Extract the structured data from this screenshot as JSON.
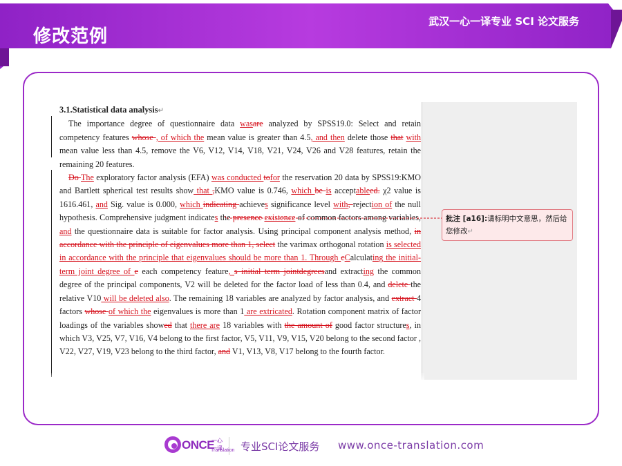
{
  "header": {
    "slide_title": "修改范例",
    "service_title": "武汉一心一译专业 SCI 论文服务",
    "band_color": "#9b29c8"
  },
  "document": {
    "heading": "3.1.Statistical data analysis",
    "para1": [
      {
        "t": "The importance degree of questionnaire data "
      },
      {
        "t": "was",
        "c": "ins"
      },
      {
        "t": "are",
        "c": "del"
      },
      {
        "t": " analyzed by SPSS19.0: Select and retain competency features "
      },
      {
        "t": "whose ",
        "c": "del"
      },
      {
        "t": ", of which the",
        "c": "ins"
      },
      {
        "t": " mean value is greater than 4.5"
      },
      {
        "t": ", and then",
        "c": "ins"
      },
      {
        "t": " delete those "
      },
      {
        "t": "that",
        "c": "del"
      },
      {
        "t": " "
      },
      {
        "t": "with",
        "c": "ins"
      },
      {
        "t": " mean value less than 4.5, remove the V6, V12, V14, V18, V21, V24, V26 and V28 features, retain the remaining 20 features."
      }
    ],
    "para2": [
      {
        "t": "Do ",
        "c": "del"
      },
      {
        "t": "The",
        "c": "ins"
      },
      {
        "t": " exploratory factor analysis (EFA) "
      },
      {
        "t": "was conducted ",
        "c": "ins"
      },
      {
        "t": "to",
        "c": "del"
      },
      {
        "t": "for",
        "c": "ins"
      },
      {
        "t": " the reservation 20 data by SPSS19:KMO and Bartlett spherical test results show"
      },
      {
        "t": " that ",
        "c": "ins"
      },
      {
        "t": ",",
        "c": "del"
      },
      {
        "t": "KMO value is 0.746, "
      },
      {
        "t": "which ",
        "c": "ins"
      },
      {
        "t": "be ",
        "c": "del"
      },
      {
        "t": "is",
        "c": "ins"
      },
      {
        "t": " accept"
      },
      {
        "t": "able",
        "c": "ins"
      },
      {
        "t": "ed.",
        "c": "del"
      },
      {
        "t": " χ2 value is 1616.461, "
      },
      {
        "t": "and",
        "c": "ins"
      },
      {
        "t": " Sig. value is 0.000, "
      },
      {
        "t": "which ",
        "c": "ins"
      },
      {
        "t": "indicating ",
        "c": "del"
      },
      {
        "t": "achieve"
      },
      {
        "t": "s",
        "c": "ins"
      },
      {
        "t": " significance level "
      },
      {
        "t": "with",
        "c": "ins"
      },
      {
        "t": ", ",
        "c": "del"
      },
      {
        "t": "reject"
      },
      {
        "t": "ion of",
        "c": "ins"
      },
      {
        "t": " the null hypothesis. Comprehensive judgment indicate"
      },
      {
        "t": "s",
        "c": "ins"
      },
      {
        "t": " the "
      },
      {
        "t": "presence",
        "c": "del"
      },
      {
        "t": " "
      },
      {
        "t": "existence",
        "c": "ins"
      },
      {
        "t": " of common factors among variables, "
      },
      {
        "t": "and",
        "c": "ins"
      },
      {
        "t": " the questionnaire data is suitable for factor analysis. Using principal component analysis method, "
      },
      {
        "t": "in accordance with the principle of eigenvalues more than 1, select",
        "c": "del"
      },
      {
        "t": " the varimax orthogonal rotation "
      },
      {
        "t": "is selected in accordance with the principle that eigenvalues should be more than 1. Through ",
        "c": "ins"
      },
      {
        "t": "c",
        "c": "del"
      },
      {
        "t": "C",
        "c": "ins"
      },
      {
        "t": "alculat"
      },
      {
        "t": "ing the initial-term joint degree of ",
        "c": "ins"
      },
      {
        "t": "e",
        "c": "del"
      },
      {
        "t": " each competency feature"
      },
      {
        "t": ", ",
        "c": "ins"
      },
      {
        "t": "s initial term jointdegrees",
        "c": "del"
      },
      {
        "t": "and extract"
      },
      {
        "t": "ing",
        "c": "ins"
      },
      {
        "t": " the common degree of the principal components, V2 will be deleted for the factor load of less than 0.4, and "
      },
      {
        "t": "delete ",
        "c": "del"
      },
      {
        "t": "the relative V10"
      },
      {
        "t": " will be deleted also",
        "c": "ins"
      },
      {
        "t": ". The remaining 18 variables are analyzed by factor analysis, and "
      },
      {
        "t": "extract ",
        "c": "del"
      },
      {
        "t": "4 factors "
      },
      {
        "t": "whose ",
        "c": "del"
      },
      {
        "t": "of which the",
        "c": "ins"
      },
      {
        "t": " eigenvalues is more than 1"
      },
      {
        "t": " are extricated",
        "c": "ins"
      },
      {
        "t": ". Rotation component matrix of factor loadings of the variables show"
      },
      {
        "t": "ed",
        "c": "del"
      },
      {
        "t": " that "
      },
      {
        "t": "there are",
        "c": "ins"
      },
      {
        "t": " 18 variables with "
      },
      {
        "t": "the amount of",
        "c": "del"
      },
      {
        "t": " good factor structure"
      },
      {
        "t": "s",
        "c": "ins"
      },
      {
        "t": ", in which V3, V25, V7, V16, V4 belong to the first factor, V5, V11, V9, V15, V20 belong to the second factor , V22, V27, V19, V23 belong to the third factor, "
      },
      {
        "t": "and",
        "c": "del"
      },
      {
        "t": " V1, V13, V8, V17 belong to the fourth factor."
      }
    ]
  },
  "comment": {
    "tag": "批注 [a16]:",
    "text": "请标明中文意思，然后给您修改"
  },
  "footer": {
    "logo_word": "ONCE",
    "logo_cn": "一心一译",
    "logo_sub": "Translation",
    "tagline": "专业SCI论文服务",
    "url": "www.once-translation.com"
  }
}
